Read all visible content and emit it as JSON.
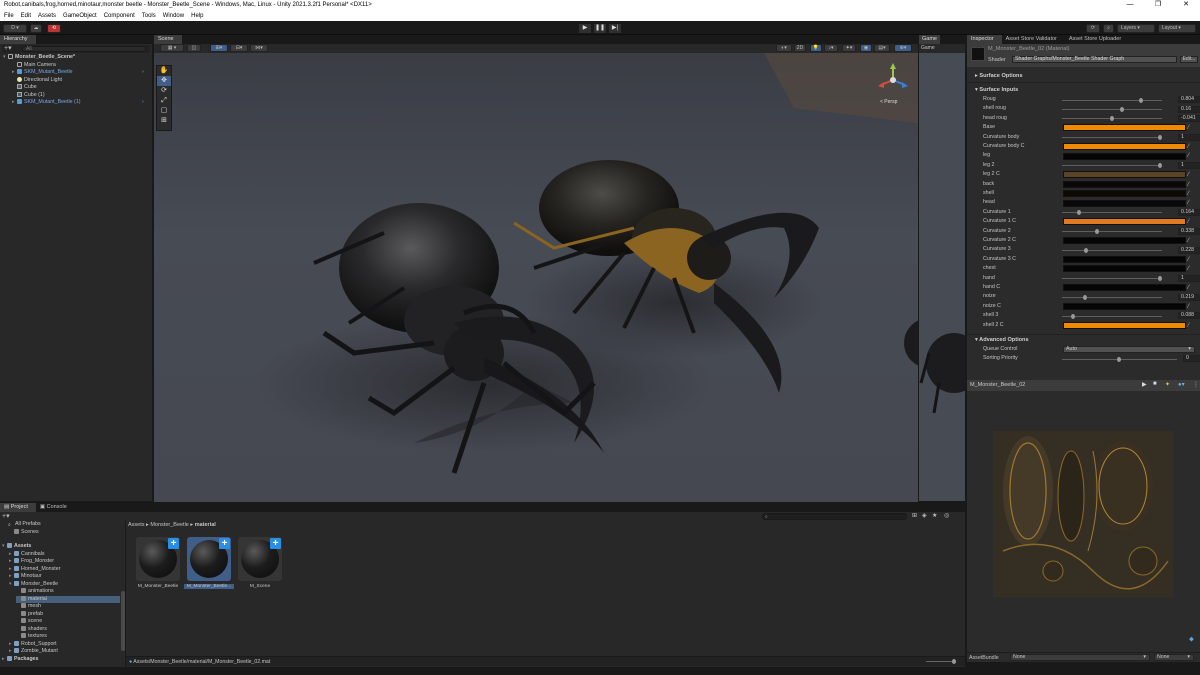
{
  "window": {
    "title": "Robot,canibals,frog,horned,minotaur,monster beetle - Monster_Beetle_Scene - Windows, Mac, Linux - Unity 2021.3.2f1 Personal* <DX11>",
    "minimize": "—",
    "maximize": "❐",
    "close": "✕"
  },
  "menu": [
    "File",
    "Edit",
    "Assets",
    "GameObject",
    "Component",
    "Tools",
    "Window",
    "Help"
  ],
  "toolbar": {
    "account": "D ▾",
    "layers": "Layers",
    "layout": "Layout",
    "play": "▶",
    "pause": "❚❚",
    "step": "▶|"
  },
  "hierarchy": {
    "tab": "Hierarchy",
    "search_placeholder": "All",
    "rows": [
      {
        "label": "Monster_Beetle_Scene*",
        "depth": 0,
        "arrow": "▾",
        "icon": "unity-icon",
        "style": "bold"
      },
      {
        "label": "Main Camera",
        "depth": 1,
        "arrow": "",
        "icon": "camera-icon",
        "style": "normal"
      },
      {
        "label": "SKM_Mutant_Beetle",
        "depth": 1,
        "arrow": "▸",
        "icon": "prefab-icon",
        "style": "blue"
      },
      {
        "label": "Directional Light",
        "depth": 1,
        "arrow": "",
        "icon": "light-icon",
        "style": "normal"
      },
      {
        "label": "Cube",
        "depth": 1,
        "arrow": "",
        "icon": "cube-icon",
        "style": "normal"
      },
      {
        "label": "Cube (1)",
        "depth": 1,
        "arrow": "",
        "icon": "cube-icon",
        "style": "normal"
      },
      {
        "label": "SKM_Mutant_Beetle (1)",
        "depth": 1,
        "arrow": "▸",
        "icon": "prefab-icon",
        "style": "blue"
      }
    ]
  },
  "scene": {
    "tab": "Scene",
    "persp": "< Persp",
    "gizmo_labels": {
      "y": "y",
      "x": "x",
      "z": "z"
    }
  },
  "game": {
    "tab": "Game",
    "display": "Game"
  },
  "inspector": {
    "tabs": [
      "Inspector",
      "Asset Store Validator",
      "Asset Store Uploader"
    ],
    "material_name": "M_Monster_Beetle_02 (Material)",
    "shader_label": "Shader",
    "shader_value": "Shader Graphs/Monster_Beetle Shader Graph",
    "edit_button": "Edit...",
    "surface_options": "Surface Options",
    "surface_inputs": "Surface Inputs",
    "properties": [
      {
        "label": "Roug",
        "type": "slider",
        "value": "0.804",
        "fraction": 0.8
      },
      {
        "label": "shell roug",
        "type": "slider",
        "value": "0.16",
        "fraction": 0.6
      },
      {
        "label": "head roug",
        "type": "slider",
        "value": "-0.041",
        "fraction": 0.5
      },
      {
        "label": "Base",
        "type": "color",
        "color": "#f08a00"
      },
      {
        "label": "Curvature body",
        "type": "slider",
        "value": "1",
        "fraction": 1.0
      },
      {
        "label": "Curvature body C",
        "type": "color",
        "color": "#f08a00"
      },
      {
        "label": "leg",
        "type": "color",
        "color": "#050505"
      },
      {
        "label": "leg 2",
        "type": "slider",
        "value": "1",
        "fraction": 1.0
      },
      {
        "label": "leg 2 C",
        "type": "color",
        "color": "#5a4327"
      },
      {
        "label": "back",
        "type": "color",
        "color": "#0a0806"
      },
      {
        "label": "shell",
        "type": "color",
        "color": "#0d0a05"
      },
      {
        "label": "head",
        "type": "color",
        "color": "#080808"
      },
      {
        "label": "Curvature 1",
        "type": "slider",
        "value": "0.164",
        "fraction": 0.16
      },
      {
        "label": "Curvature 1 C",
        "type": "color",
        "color": "#e07a22"
      },
      {
        "label": "Curvature 2",
        "type": "slider",
        "value": "0.338",
        "fraction": 0.34
      },
      {
        "label": "Curvature 2 C",
        "type": "color",
        "color": "#050505"
      },
      {
        "label": "Curvature 3",
        "type": "slider",
        "value": "0.228",
        "fraction": 0.23
      },
      {
        "label": "Curvature 3 C",
        "type": "color",
        "color": "#050505"
      },
      {
        "label": "chest",
        "type": "color",
        "color": "#050505"
      },
      {
        "label": "hand",
        "type": "slider",
        "value": "1",
        "fraction": 1.0
      },
      {
        "label": "hand C",
        "type": "color",
        "color": "#050505"
      },
      {
        "label": "noize",
        "type": "slider",
        "value": "0.219",
        "fraction": 0.22
      },
      {
        "label": "noize C",
        "type": "color",
        "color": "#050505"
      },
      {
        "label": "shell 3",
        "type": "slider",
        "value": "0.088",
        "fraction": 0.09
      },
      {
        "label": "shell 2 C",
        "type": "color",
        "color": "#f08a00"
      }
    ],
    "advanced_options": "Advanced Options",
    "queue_control_label": "Queue Control",
    "queue_control_value": "Auto",
    "sorting_priority_label": "Sorting Priority",
    "sorting_priority_value": "0",
    "preview_title": "M_Monster_Beetle_02",
    "assetbundle_label": "AssetBundle",
    "assetbundle_value": "None",
    "assetbundle_variant": "None"
  },
  "project": {
    "tabs": [
      "Project",
      "Console"
    ],
    "favorites": [
      "All Prefabs",
      "Scenes"
    ],
    "tree": [
      {
        "label": "Assets",
        "depth": 0,
        "arrow": "▾",
        "bold": true
      },
      {
        "label": "Cannibals",
        "depth": 1,
        "arrow": "▸"
      },
      {
        "label": "Frog_Monster",
        "depth": 1,
        "arrow": "▸"
      },
      {
        "label": "Horned_Monster",
        "depth": 1,
        "arrow": "▸"
      },
      {
        "label": "Minotaur",
        "depth": 1,
        "arrow": "▸"
      },
      {
        "label": "Monster_Beetle",
        "depth": 1,
        "arrow": "▾"
      },
      {
        "label": "animations",
        "depth": 2,
        "arrow": ""
      },
      {
        "label": "material",
        "depth": 2,
        "arrow": "",
        "selected": true
      },
      {
        "label": "mesh",
        "depth": 2,
        "arrow": ""
      },
      {
        "label": "prefab",
        "depth": 2,
        "arrow": ""
      },
      {
        "label": "scene",
        "depth": 2,
        "arrow": ""
      },
      {
        "label": "shaders",
        "depth": 2,
        "arrow": ""
      },
      {
        "label": "textures",
        "depth": 2,
        "arrow": ""
      },
      {
        "label": "Robot_Support",
        "depth": 1,
        "arrow": "▸"
      },
      {
        "label": "Zombie_Mutant",
        "depth": 1,
        "arrow": "▸"
      },
      {
        "label": "Packages",
        "depth": 0,
        "arrow": "▸",
        "bold": true
      }
    ],
    "breadcrumb": [
      "Assets",
      "Monster_Beetle",
      "material"
    ],
    "assets": [
      {
        "label": "M_Monster_Beetle",
        "selected": false
      },
      {
        "label": "M_Monster_Beetle...",
        "selected": true
      },
      {
        "label": "M_Scene",
        "selected": false
      }
    ],
    "status_path": "Assets/Monster_Beetle/material/M_Monster_Beetle_02.mat"
  }
}
